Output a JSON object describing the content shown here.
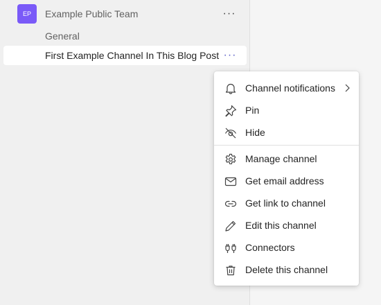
{
  "team": {
    "initials": "EP",
    "name": "Example Public Team",
    "avatar_color": "#7a5af8",
    "more_glyph": "···"
  },
  "channels": [
    {
      "label": "General"
    },
    {
      "label": "First Example Channel In This Blog Post",
      "selected": true
    }
  ],
  "channel_more_glyph": "···",
  "menu": {
    "items": [
      {
        "label": "Channel notifications",
        "icon": "bell-icon",
        "has_submenu": true
      },
      {
        "label": "Pin",
        "icon": "pin-icon"
      },
      {
        "label": "Hide",
        "icon": "eye-off-icon"
      },
      {
        "label": "Manage channel",
        "icon": "gear-icon"
      },
      {
        "label": "Get email address",
        "icon": "mail-icon"
      },
      {
        "label": "Get link to channel",
        "icon": "link-icon"
      },
      {
        "label": "Edit this channel",
        "icon": "pencil-icon"
      },
      {
        "label": "Connectors",
        "icon": "connectors-icon"
      },
      {
        "label": "Delete this channel",
        "icon": "trash-icon"
      }
    ]
  },
  "colors": {
    "accent": "#5b5fc7",
    "sidebar_bg": "#f0f0f0",
    "selected_bg": "#ffffff"
  }
}
